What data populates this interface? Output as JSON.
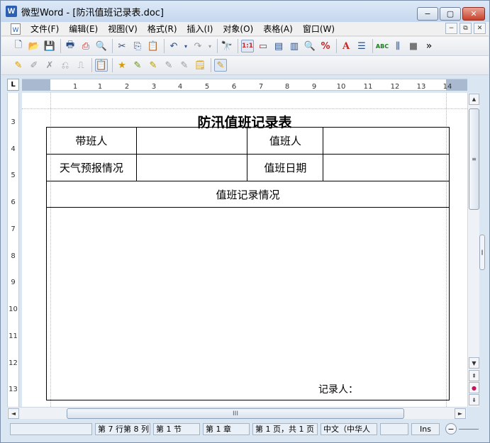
{
  "window": {
    "title": "微型Word - [防汛值班记录表.doc]",
    "app_icon": "W",
    "buttons": {
      "minimize": "−",
      "maximize": "▢",
      "close": "✕"
    }
  },
  "menubar": {
    "items": [
      "文件(F)",
      "编辑(E)",
      "视图(V)",
      "格式(R)",
      "插入(I)",
      "对象(O)",
      "表格(A)",
      "窗口(W)"
    ],
    "mdi_buttons": [
      "−",
      "⧉",
      "✕"
    ]
  },
  "toolbar1": {
    "icons": [
      "new-icon",
      "open-icon",
      "save-icon",
      "print-icon",
      "pdf-icon",
      "print-preview-icon",
      "cut-icon",
      "copy-icon",
      "paste-icon",
      "undo-icon",
      "redo-icon",
      "find-icon",
      "zoom-actual-icon",
      "page-width-icon",
      "page-view-icon",
      "two-page-icon",
      "zoom-icon",
      "zoom-percent-icon",
      "font-color-icon",
      "insert-field-icon",
      "spellcheck-icon",
      "pages-icon",
      "gray-square-icon",
      "more-icon"
    ],
    "glyphs": {
      "new": "🗋",
      "open": "📂",
      "save": "💾",
      "print": "🖶",
      "pdf": "⎙",
      "preview": "🔍",
      "cut": "✂",
      "copy": "⎘",
      "paste": "📋",
      "undo": "↶",
      "redo": "↷",
      "find": "🔭",
      "zoom_actual": "1:1",
      "page_width": "▭",
      "page_view": "▤",
      "two_page": "▥",
      "zoom": "🔍",
      "zoom_pct": "%",
      "font_color": "A",
      "field": "☰",
      "spell": "ABC",
      "pages": "⫼",
      "gray": "■",
      "more": "»"
    }
  },
  "toolbar2": {
    "icons": [
      "revision-icon",
      "edit-icon",
      "delete-icon",
      "accept-icon",
      "reject-icon",
      "comment-icon",
      "highlight-icon",
      "pen-icon",
      "pen2-icon",
      "pen3-icon",
      "pen4-icon",
      "note-icon",
      "track-icon"
    ],
    "glyphs": [
      "✎",
      "✐",
      "✗",
      "⎌",
      "⎍",
      "📋",
      "★",
      "✎",
      "✎",
      "✎",
      "✎",
      "🗒",
      "✎"
    ]
  },
  "ruler": {
    "corner": "L",
    "h_ticks": [
      "1",
      "1",
      "2",
      "3",
      "4",
      "5",
      "6",
      "7",
      "8",
      "9",
      "10",
      "11",
      "12",
      "13",
      "14"
    ],
    "v_ticks": [
      "3",
      "4",
      "5",
      "6",
      "7",
      "8",
      "9",
      "10",
      "11",
      "12",
      "13"
    ]
  },
  "document": {
    "title": "防汛值班记录表",
    "table": {
      "row1": [
        "带班人",
        "",
        "值班人",
        ""
      ],
      "row2": [
        "天气预报情况",
        "",
        "值班日期",
        ""
      ],
      "row3": "值班记录情况",
      "recorder_label": "记录人："
    }
  },
  "scrollbar": {
    "up": "▲",
    "down": "▼",
    "left": "◄",
    "right": "►",
    "grip": "III",
    "prev_page": "⇞",
    "select_browse": "●",
    "next_page": "⇟"
  },
  "statusbar": {
    "cells": [
      "",
      "第 7 行第 8 列",
      "第 1 节",
      "第 1 章",
      "第 1 页，共 1 页",
      "中文（中华人",
      "",
      "Ins"
    ],
    "zoom_minus": "−"
  }
}
